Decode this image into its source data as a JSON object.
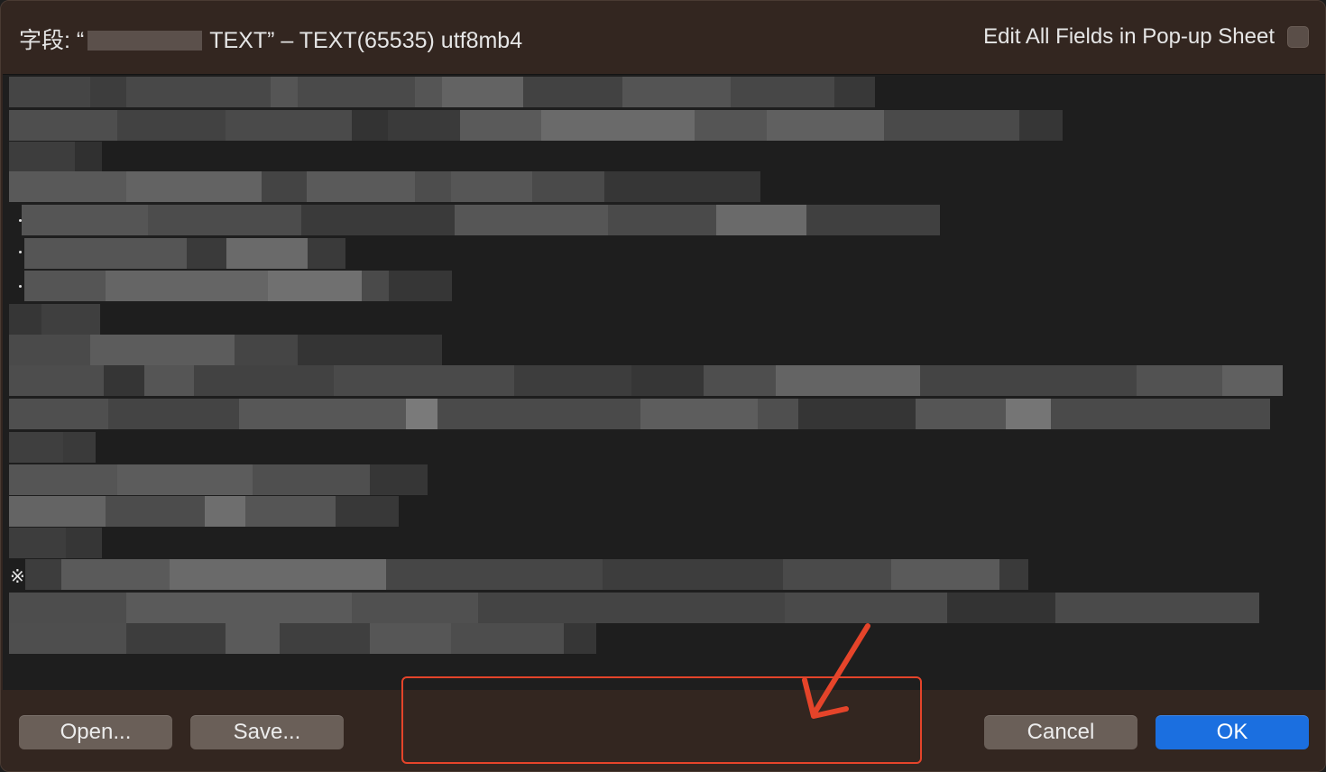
{
  "sheet": {
    "title_prefix": "字段: “",
    "title_suffix": "TEXT” – TEXT(65535) utf8mb4",
    "edit_all_label": "Edit All Fields in Pop-up Sheet",
    "edit_all_checked": false
  },
  "editor": {
    "content_redacted": true,
    "asterism": "※"
  },
  "footer": {
    "open_label": "Open...",
    "save_label": "Save...",
    "cancel_label": "Cancel",
    "ok_label": "OK"
  },
  "colors": {
    "sheet_bg": "#332620",
    "editor_bg": "#1e1e1e",
    "primary_button": "#1b6fe0",
    "secondary_button": "#6a5f58",
    "annotation_red": "#e5442a"
  }
}
